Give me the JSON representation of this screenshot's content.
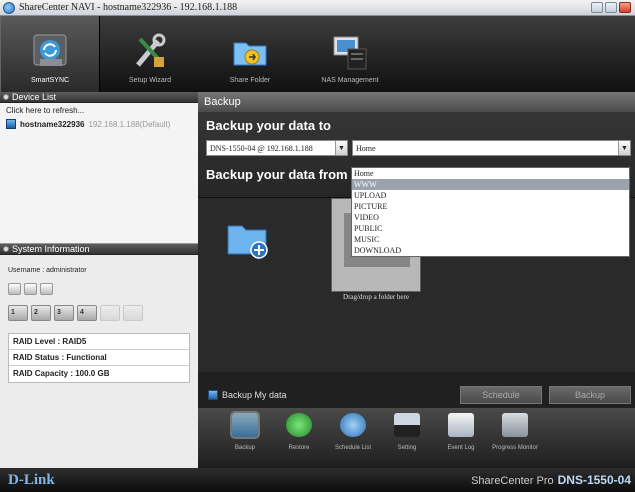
{
  "window": {
    "title": "ShareCenter NAVI - hostname322936 - 192.168.1.188"
  },
  "topnav": {
    "items": [
      {
        "label": "SmartSYNC",
        "icon": "smartsync-icon",
        "active": true
      },
      {
        "label": "Setup Wizard",
        "icon": "wrench-icon"
      },
      {
        "label": "Share Folder",
        "icon": "share-folder-icon"
      },
      {
        "label": "NAS Management",
        "icon": "nas-icon"
      }
    ]
  },
  "device_list": {
    "header": "Device List",
    "refresh": "Click here to refresh...",
    "device_name": "hostname322936",
    "device_ip": "192.168.1.188(Default)"
  },
  "system_info": {
    "header": "System Information",
    "username": "Username : administrator",
    "disks": [
      "1",
      "2",
      "3",
      "4",
      "",
      ""
    ],
    "raid_level": "RAID Level : RAID5",
    "raid_status": "RAID Status : Functional",
    "raid_capacity": "RAID Capacity : 100.0 GB"
  },
  "backup": {
    "header": "Backup",
    "to_title": "Backup your data to",
    "device_select": "DNS-1550-04 @ 192.168.1.188",
    "share_select": "Home",
    "share_options": [
      "Home",
      "WWW",
      "UPLOAD",
      "PICTURE",
      "VIDEO",
      "PUBLIC",
      "MUSIC",
      "DOWNLOAD"
    ],
    "share_highlight": "WWW",
    "from_title": "Backup your data from",
    "drag_hint": "Drag/drop a folder here",
    "checkbox_label": "Backup My data",
    "schedule_btn": "Schedule",
    "backup_btn": "Backup"
  },
  "tools": [
    {
      "label": "Backup",
      "icon": "backup-icon",
      "active": true
    },
    {
      "label": "Restore",
      "icon": "restore-icon"
    },
    {
      "label": "Schedule List",
      "icon": "schedule-list-icon"
    },
    {
      "label": "Setting",
      "icon": "setting-icon"
    },
    {
      "label": "Event Log",
      "icon": "event-log-icon"
    },
    {
      "label": "Progress Monitor",
      "icon": "progress-monitor-icon"
    }
  ],
  "footer": {
    "logo": "D-Link",
    "brand": "ShareCenter Pro",
    "model": "DNS-1550-04"
  },
  "colors": {
    "accent": "#7fb6e8",
    "highlight": "#9aa3ad"
  }
}
